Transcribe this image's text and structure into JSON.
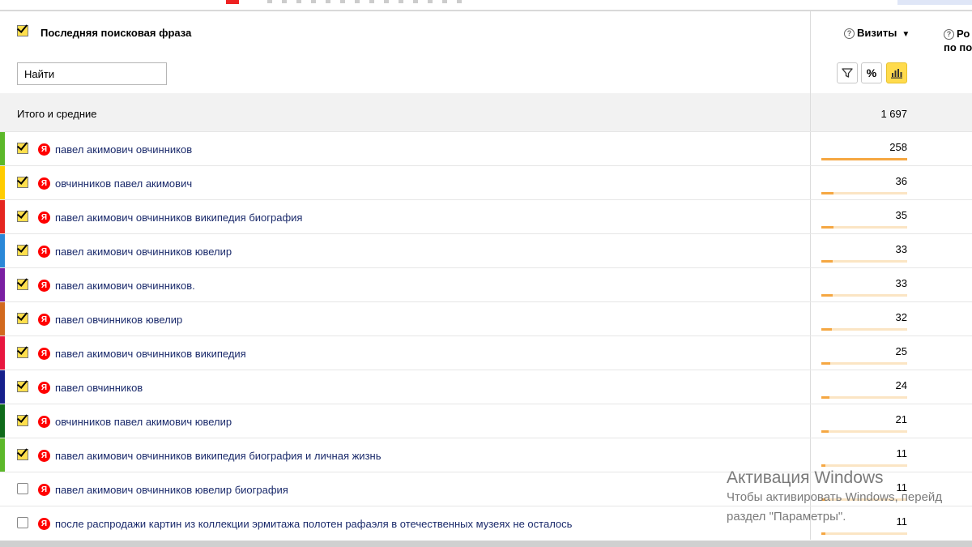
{
  "table": {
    "dimension_header": "Последняя поисковая фраза",
    "search_placeholder": "Найти",
    "metric_header": "Визиты",
    "metric_sort_indicator": "▼",
    "next_column_header_line1": "Ро",
    "next_column_header_line2": "по по",
    "totals_label": "Итого и средние",
    "totals_value": "1 697",
    "rows": [
      {
        "phrase": "павел акимович овчинников",
        "visits": "258",
        "checked": true,
        "stripe_color": "#5cb82a",
        "share": 1.0
      },
      {
        "phrase": "овчинников павел акимович",
        "visits": "36",
        "checked": true,
        "stripe_color": "#ffcc00",
        "share": 0.14
      },
      {
        "phrase": "павел акимович овчинников википедия биография",
        "visits": "35",
        "checked": true,
        "stripe_color": "#e52620",
        "share": 0.14
      },
      {
        "phrase": "павел акимович овчинников ювелир",
        "visits": "33",
        "checked": true,
        "stripe_color": "#2a88d8",
        "share": 0.13
      },
      {
        "phrase": "павел акимович овчинников.",
        "visits": "33",
        "checked": true,
        "stripe_color": "#7a1fa2",
        "share": 0.13
      },
      {
        "phrase": "павел овчинников ювелир",
        "visits": "32",
        "checked": true,
        "stripe_color": "#d2691e",
        "share": 0.12
      },
      {
        "phrase": "павел акимович овчинников википедия",
        "visits": "25",
        "checked": true,
        "stripe_color": "#e8173f",
        "share": 0.1
      },
      {
        "phrase": "павел овчинников",
        "visits": "24",
        "checked": true,
        "stripe_color": "#16208c",
        "share": 0.09
      },
      {
        "phrase": "овчинников павел акимович ювелир",
        "visits": "21",
        "checked": true,
        "stripe_color": "#0f6b1a",
        "share": 0.08
      },
      {
        "phrase": "павел акимович овчинников википедия биография и личная жизнь",
        "visits": "11",
        "checked": true,
        "stripe_color": "#5cb82a",
        "share": 0.05
      },
      {
        "phrase": "павел акимович овчинников ювелир биография",
        "visits": "11",
        "checked": false,
        "stripe_color": "",
        "share": 0.05
      },
      {
        "phrase": "после распродажи картин из коллекции эрмитажа полотен рафаэля в отечественных музеях не осталось",
        "visits": "11",
        "checked": false,
        "stripe_color": "",
        "share": 0.05
      }
    ]
  },
  "watermark": {
    "line1": "Активация Windows",
    "line2": "Чтобы активировать Windows, перейд",
    "line3": "раздел \"Параметры\"."
  },
  "icons": {
    "help": "question-circle-icon",
    "filter": "filter-icon",
    "percent": "percent-icon",
    "bars": "bar-chart-icon",
    "search_engine": "yandex-icon"
  },
  "colors": {
    "accent_yellow": "#ffdb4d",
    "bar_fill": "#f5a742",
    "bar_track": "#fbe5c4",
    "link_text": "#1a2a6b",
    "totals_bg": "#f2f2f2"
  }
}
